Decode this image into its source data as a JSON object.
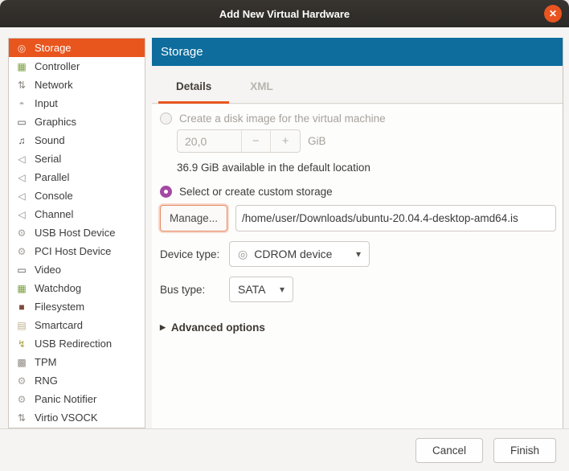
{
  "window": {
    "title": "Add New Virtual Hardware",
    "close_glyph": "✕"
  },
  "sidebar": {
    "items": [
      {
        "label": "Storage",
        "icon": "disk-icon",
        "glyph": "◎",
        "color": "#8d8883",
        "selected": true
      },
      {
        "label": "Controller",
        "icon": "controller-card-icon",
        "glyph": "▦",
        "color": "#7b9e3e",
        "selected": false
      },
      {
        "label": "Network",
        "icon": "network-arrows-icon",
        "glyph": "⇅",
        "color": "#8d8883",
        "selected": false
      },
      {
        "label": "Input",
        "icon": "mouse-icon",
        "glyph": "◓",
        "color": "#b5b0ab",
        "selected": false
      },
      {
        "label": "Graphics",
        "icon": "monitor-icon",
        "glyph": "▭",
        "color": "#4a4a4a",
        "selected": false
      },
      {
        "label": "Sound",
        "icon": "music-note-icon",
        "glyph": "♫",
        "color": "#4a4a4a",
        "selected": false
      },
      {
        "label": "Serial",
        "icon": "serial-port-icon",
        "glyph": "◁",
        "color": "#8d8883",
        "selected": false
      },
      {
        "label": "Parallel",
        "icon": "parallel-port-icon",
        "glyph": "◁",
        "color": "#8d8883",
        "selected": false
      },
      {
        "label": "Console",
        "icon": "console-port-icon",
        "glyph": "◁",
        "color": "#8d8883",
        "selected": false
      },
      {
        "label": "Channel",
        "icon": "channel-port-icon",
        "glyph": "◁",
        "color": "#8d8883",
        "selected": false
      },
      {
        "label": "USB Host Device",
        "icon": "usb-host-gears-icon",
        "glyph": "⚙",
        "color": "#a5a09b",
        "selected": false
      },
      {
        "label": "PCI Host Device",
        "icon": "pci-host-gears-icon",
        "glyph": "⚙",
        "color": "#a5a09b",
        "selected": false
      },
      {
        "label": "Video",
        "icon": "video-monitor-icon",
        "glyph": "▭",
        "color": "#4a4a4a",
        "selected": false
      },
      {
        "label": "Watchdog",
        "icon": "watchdog-card-icon",
        "glyph": "▦",
        "color": "#7b9e3e",
        "selected": false
      },
      {
        "label": "Filesystem",
        "icon": "folder-icon",
        "glyph": "■",
        "color": "#7d4a3c",
        "selected": false
      },
      {
        "label": "Smartcard",
        "icon": "smartcard-reader-icon",
        "glyph": "▤",
        "color": "#bfae8e",
        "selected": false
      },
      {
        "label": "USB Redirection",
        "icon": "usb-redirect-icon",
        "glyph": "↯",
        "color": "#a8a23c",
        "selected": false
      },
      {
        "label": "TPM",
        "icon": "tpm-chip-icon",
        "glyph": "▩",
        "color": "#8d8883",
        "selected": false
      },
      {
        "label": "RNG",
        "icon": "rng-gears-icon",
        "glyph": "⚙",
        "color": "#a5a09b",
        "selected": false
      },
      {
        "label": "Panic Notifier",
        "icon": "panic-gears-icon",
        "glyph": "⚙",
        "color": "#a5a09b",
        "selected": false
      },
      {
        "label": "Virtio VSOCK",
        "icon": "vsock-arrows-icon",
        "glyph": "⇅",
        "color": "#8d8883",
        "selected": false
      }
    ]
  },
  "header": {
    "title": "Storage"
  },
  "tabs": [
    {
      "label": "Details",
      "active": true
    },
    {
      "label": "XML",
      "active": false
    }
  ],
  "details": {
    "create_disk_radio_label": "Create a disk image for the virtual machine",
    "size_value": "20,0",
    "minus_glyph": "−",
    "plus_glyph": "+",
    "size_unit": "GiB",
    "available_text": "36.9 GiB available in the default location",
    "custom_radio_label": "Select or create custom storage",
    "manage_button_label": "Manage...",
    "storage_path_value": "/home/user/Downloads/ubuntu-20.04.4-desktop-amd64.is",
    "device_type_label": "Device type:",
    "device_type_value": "CDROM device",
    "cd_glyph": "◎",
    "dropdown_arrow_glyph": "▾",
    "bus_type_label": "Bus type:",
    "bus_type_value": "SATA",
    "advanced_expander_glyph": "▶",
    "advanced_label": "Advanced options"
  },
  "actions": {
    "cancel_label": "Cancel",
    "finish_label": "Finish"
  },
  "colors": {
    "accent_orange": "#e8561e",
    "header_blue": "#0e6d9d",
    "radio_selected_purple": "#a449a3",
    "titlebar": "#2c2a27",
    "close_button": "#e95420"
  }
}
